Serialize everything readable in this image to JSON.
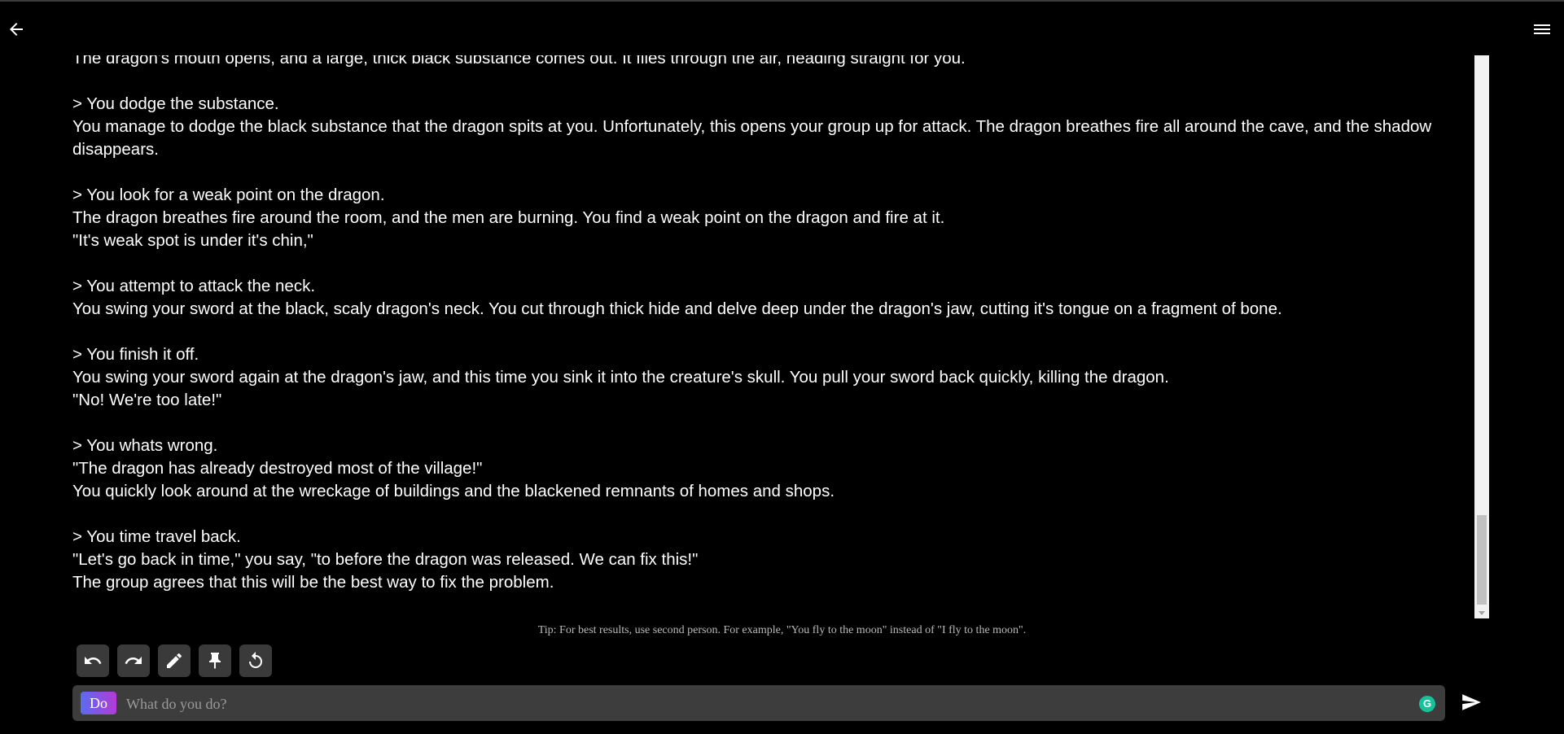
{
  "nav": {
    "back_icon": "arrow-left-icon",
    "menu_icon": "hamburger-menu-icon"
  },
  "story": {
    "blocks": [
      [
        "The dragon's mouth opens, and a large, thick black substance comes out. It flies through the air, heading straight for you."
      ],
      [
        "> You dodge the substance.",
        "You manage to dodge the black substance that the dragon spits at you. Unfortunately, this opens your group up for attack. The dragon breathes fire all around the cave, and the shadow disappears."
      ],
      [
        "> You look for a weak point on the dragon.",
        "The dragon breathes fire around the room, and the men are burning. You find a weak point on the dragon and fire at it.",
        "\"It's weak spot is under it's chin,\""
      ],
      [
        "> You attempt to attack the neck.",
        "You swing your sword at the black, scaly dragon's neck. You cut through thick hide and delve deep under the dragon's jaw, cutting it's tongue on a fragment of bone."
      ],
      [
        "> You finish it off.",
        "You swing your sword again at the dragon's jaw, and this time you sink it into the creature's skull. You pull your sword back quickly, killing the dragon.",
        "\"No! We're too late!\""
      ],
      [
        "> You whats wrong.",
        "\"The dragon has already destroyed most of the village!\"",
        "You quickly look around at the wreckage of buildings and the blackened remnants of homes and shops."
      ],
      [
        "> You time travel back.",
        "\"Let's go back in time,\" you say, \"to before the dragon was released. We can fix this!\"",
        "The group agrees that this will be the best way to fix the problem."
      ]
    ]
  },
  "tip": "Tip: For best results, use second person. For example, \"You fly to the moon\" instead of \"I fly to the moon\".",
  "toolbar": {
    "buttons": [
      "undo-icon",
      "redo-icon",
      "pencil-icon",
      "pin-icon",
      "retry-icon"
    ]
  },
  "input": {
    "mode_label": "Do",
    "placeholder": "What do you do?",
    "value": "",
    "grammarly_label": "G"
  },
  "colors": {
    "background": "#000000",
    "input_bg": "#3d3d3d",
    "button_bg": "#3a3a3a",
    "badge_gradient_start": "#5b6cf0",
    "badge_gradient_end": "#b43ad6",
    "grammarly": "#15c39a"
  }
}
